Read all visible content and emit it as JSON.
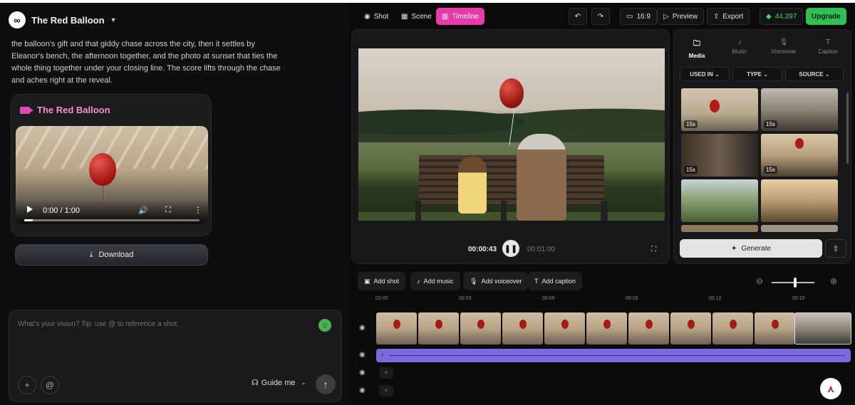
{
  "project": {
    "title": "The Red Balloon",
    "logo": "infinity-logo"
  },
  "chat": {
    "message": "the balloon's gift and that giddy chase across the city, then it settles by Eleanor's bench, the afternoon together, and the photo at sunset that ties the whole thing together under your closing line. The score lifts through the chase and aches right at the reveal."
  },
  "video_card": {
    "title": "The Red Balloon",
    "time": "0:00 / 1:00",
    "progress_fraction": 0.05,
    "download_label": "Download"
  },
  "composer": {
    "placeholder": "What's your vision? Tip: use @ to reference a shot.",
    "plus": "+",
    "at": "@",
    "guide_label": "Guide me",
    "send_icon": "↑"
  },
  "toolbar": {
    "shot": "Shot",
    "scene": "Scene",
    "timeline": "Timeline",
    "aspect": "16:9",
    "preview": "Preview",
    "export": "Export",
    "credits": "44,397",
    "upgrade": "Upgrade"
  },
  "player": {
    "current": "00:00:43",
    "total": "00:01:00"
  },
  "media": {
    "tabs": [
      "Media",
      "Music",
      "Voiceover",
      "Caption"
    ],
    "active_tab": "Media",
    "filters": [
      "USED IN",
      "TYPE",
      "SOURCE"
    ],
    "thumbs": [
      {
        "badge": "15s"
      },
      {
        "badge": "15s"
      },
      {
        "badge": "15s"
      },
      {
        "badge": "15s"
      },
      {
        "badge": ""
      },
      {
        "badge": ""
      }
    ],
    "generate": "Generate"
  },
  "timeline": {
    "buttons": [
      "Add shot",
      "Add music",
      "Add voiceover",
      "Add caption"
    ],
    "ticks": [
      "00:00",
      "00:03",
      "00:06",
      "00:09",
      "00:12",
      "00:15"
    ],
    "zoom_fraction": 0.55
  },
  "colors": {
    "accent": "#e83aa9",
    "upgrade": "#2fbf55",
    "audio": "#7a6ae0"
  }
}
